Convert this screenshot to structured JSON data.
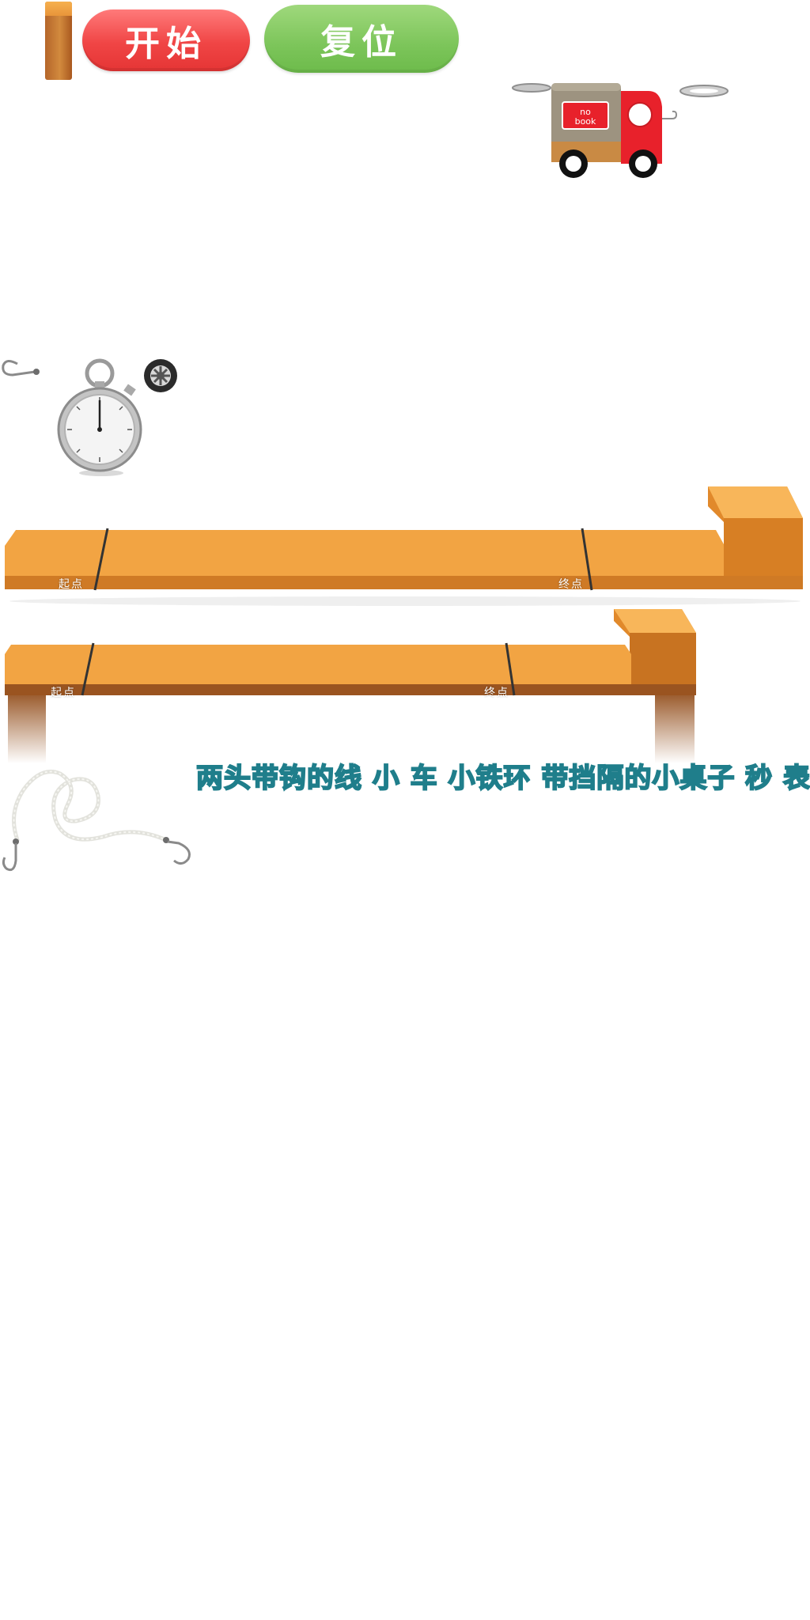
{
  "controls": {
    "start_label": "开始",
    "reset_label": "复位"
  },
  "truck": {
    "sign_text": "no book",
    "body_color": "#e8212b",
    "cargo_color": "#9d9380"
  },
  "tables": {
    "upper": {
      "start_label": "起点",
      "end_label": "终点"
    },
    "lower": {
      "start_label": "起点",
      "end_label": "终点"
    }
  },
  "caption": {
    "text": "两头带钩的线 小 车 小铁环 带挡隔的小桌子 秒 表"
  },
  "icons": [
    "hook-icon",
    "stopwatch-icon",
    "wheel-icon",
    "truck-icon",
    "rope-icon"
  ],
  "colors": {
    "start_button": "#f04545",
    "reset_button": "#7cc55a",
    "wood": "#f3a544",
    "caption": "#3ab0c0"
  }
}
